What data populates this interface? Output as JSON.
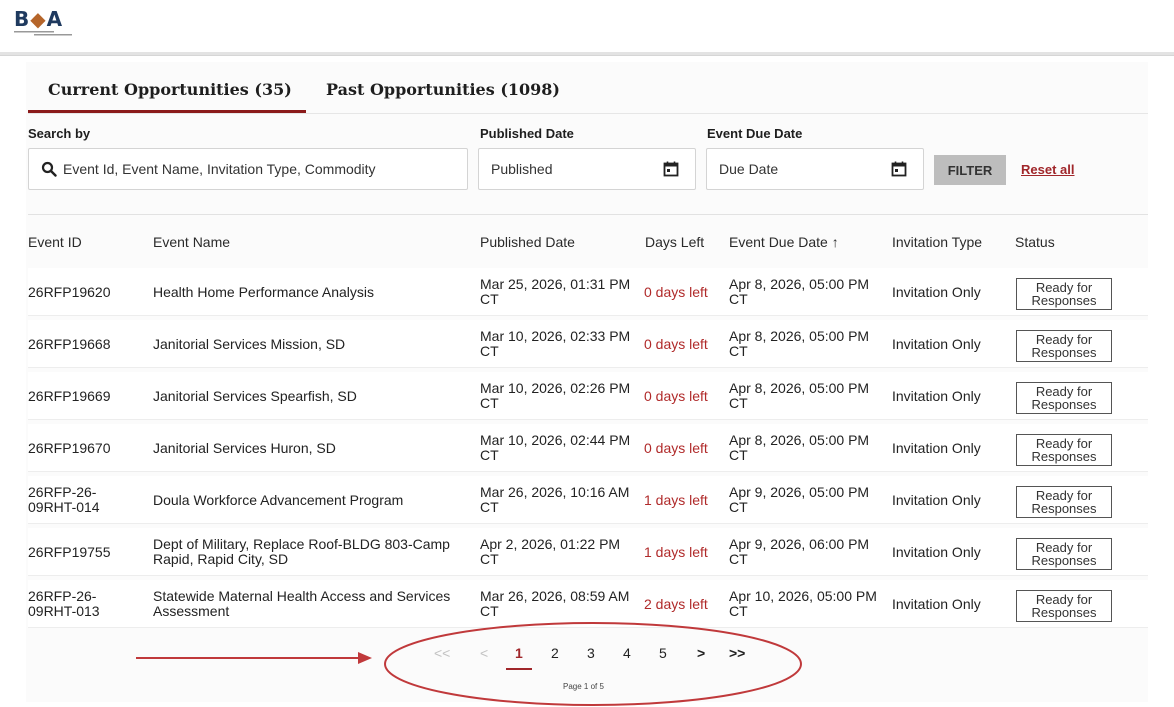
{
  "logo": {
    "text_main": "B",
    "text_drop": "◆",
    "text_tail": "A"
  },
  "tabs": {
    "current": "Current Opportunities (35)",
    "past": "Past Opportunities (1098)"
  },
  "filters": {
    "search_label": "Search by",
    "search_placeholder": "Event Id, Event Name, Invitation Type, Commodity",
    "published_label": "Published Date",
    "published_placeholder": "Published",
    "due_label": "Event Due Date",
    "due_placeholder": "Due Date",
    "filter_button": "FILTER",
    "reset_link": "Reset all"
  },
  "table": {
    "headers": {
      "event_id": "Event ID",
      "event_name": "Event Name",
      "published": "Published Date",
      "days_left": "Days Left",
      "due": "Event Due Date",
      "due_sort": "↑",
      "invitation": "Invitation Type",
      "status": "Status"
    },
    "rows": [
      {
        "id": "26RFP19620",
        "name": "Health Home Performance Analysis",
        "published": "Mar 25, 2026, 01:31 PM CT",
        "days": "0 days left",
        "due": "Apr 8, 2026, 05:00 PM CT",
        "invitation": "Invitation Only",
        "status": "Ready for Responses"
      },
      {
        "id": "26RFP19668",
        "name": "Janitorial Services Mission, SD",
        "published": "Mar 10, 2026, 02:33 PM CT",
        "days": "0 days left",
        "due": "Apr 8, 2026, 05:00 PM CT",
        "invitation": "Invitation Only",
        "status": "Ready for Responses"
      },
      {
        "id": "26RFP19669",
        "name": "Janitorial Services Spearfish, SD",
        "published": "Mar 10, 2026, 02:26 PM CT",
        "days": "0 days left",
        "due": "Apr 8, 2026, 05:00 PM CT",
        "invitation": "Invitation Only",
        "status": "Ready for Responses"
      },
      {
        "id": "26RFP19670",
        "name": "Janitorial Services Huron, SD",
        "published": "Mar 10, 2026, 02:44 PM CT",
        "days": "0 days left",
        "due": "Apr 8, 2026, 05:00 PM CT",
        "invitation": "Invitation Only",
        "status": "Ready for Responses"
      },
      {
        "id": "26RFP-26-09RHT-014",
        "name": "Doula Workforce Advancement Program",
        "published": "Mar 26, 2026, 10:16 AM CT",
        "days": "1 days left",
        "due": "Apr 9, 2026, 05:00 PM CT",
        "invitation": "Invitation Only",
        "status": "Ready for Responses"
      },
      {
        "id": "26RFP19755",
        "name": "Dept of Military, Replace Roof-BLDG 803-Camp Rapid, Rapid City, SD",
        "published": "Apr 2, 2026, 01:22 PM CT",
        "days": "1 days left",
        "due": "Apr 9, 2026, 06:00 PM CT",
        "invitation": "Invitation Only",
        "status": "Ready for Responses"
      },
      {
        "id": "26RFP-26-09RHT-013",
        "name": "Statewide Maternal Health Access and Services Assessment",
        "published": "Mar 26, 2026, 08:59 AM CT",
        "days": "2 days left",
        "due": "Apr 10, 2026, 05:00 PM CT",
        "invitation": "Invitation Only",
        "status": "Ready for Responses"
      }
    ]
  },
  "pagination": {
    "first": "<<",
    "prev": "<",
    "pages": [
      "1",
      "2",
      "3",
      "4",
      "5"
    ],
    "next": ">",
    "last": ">>",
    "info": "Page 1 of 5"
  },
  "colors": {
    "accent": "#a0262a",
    "annotation": "#c0393b"
  }
}
